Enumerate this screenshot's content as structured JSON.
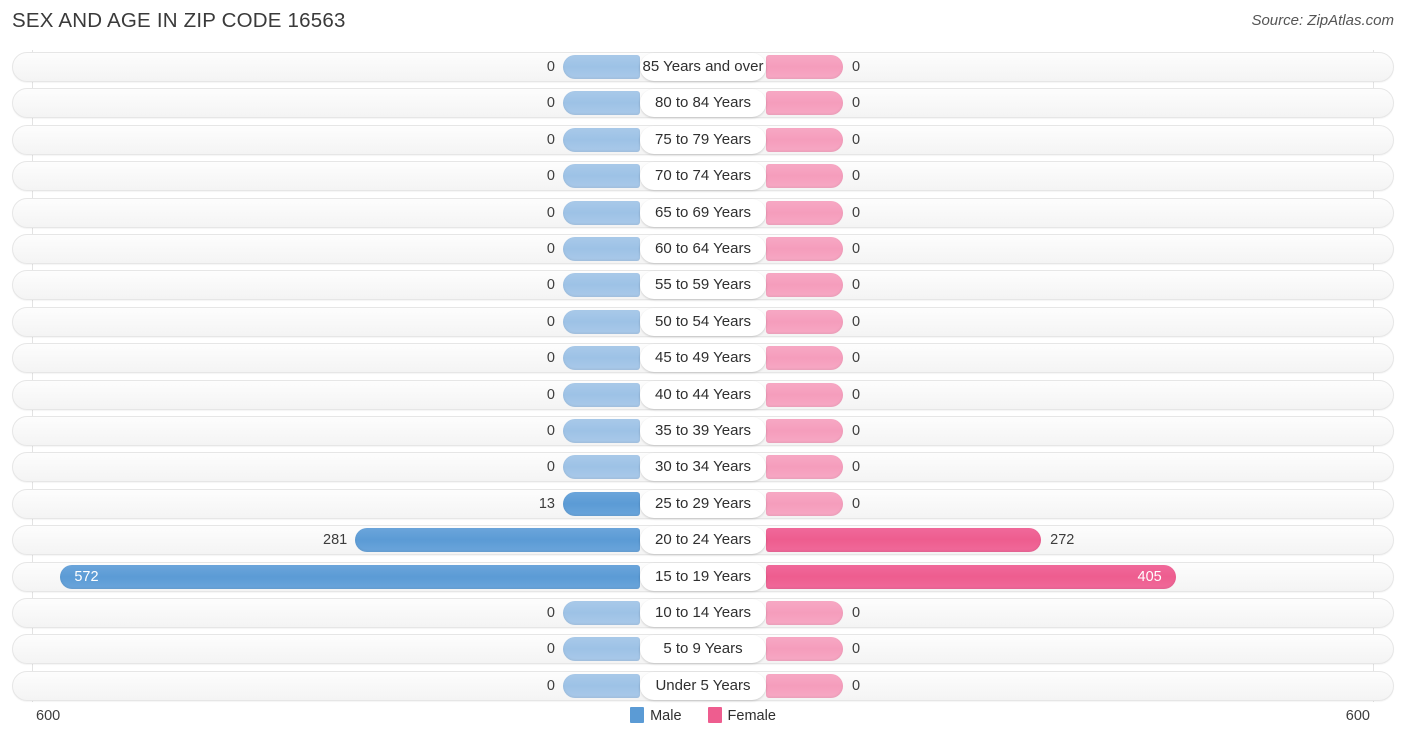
{
  "header": {
    "title": "SEX AND AGE IN ZIP CODE 16563",
    "source": "Source: ZipAtlas.com"
  },
  "axis": {
    "left_max_label": "600",
    "right_max_label": "600"
  },
  "legend": {
    "items": [
      {
        "label": "Male",
        "color": "#5b9bd5",
        "swatch": "male"
      },
      {
        "label": "Female",
        "color": "#ee5d8f",
        "swatch": "female"
      }
    ]
  },
  "colors": {
    "male_solid": "#5b9bd5",
    "female_solid": "#ee5d8f",
    "male_pastel": "#a8c8e8",
    "female_pastel": "#f6a4c0",
    "row_track": "#f4f4f4",
    "gridline": "#e3e3e3"
  },
  "chart_data": {
    "type": "bar",
    "subtype": "population-pyramid",
    "title": "SEX AND AGE IN ZIP CODE 16563",
    "xlabel": "",
    "ylabel": "",
    "xlim": [
      0,
      600
    ],
    "grid": true,
    "legend_position": "bottom-center",
    "categories": [
      "85 Years and over",
      "80 to 84 Years",
      "75 to 79 Years",
      "70 to 74 Years",
      "65 to 69 Years",
      "60 to 64 Years",
      "55 to 59 Years",
      "50 to 54 Years",
      "45 to 49 Years",
      "40 to 44 Years",
      "35 to 39 Years",
      "30 to 34 Years",
      "25 to 29 Years",
      "20 to 24 Years",
      "15 to 19 Years",
      "10 to 14 Years",
      "5 to 9 Years",
      "Under 5 Years"
    ],
    "series": [
      {
        "name": "Male",
        "color": "#5b9bd5",
        "values": [
          0,
          0,
          0,
          0,
          0,
          0,
          0,
          0,
          0,
          0,
          0,
          0,
          13,
          281,
          572,
          0,
          0,
          0
        ]
      },
      {
        "name": "Female",
        "color": "#ee5d8f",
        "values": [
          0,
          0,
          0,
          0,
          0,
          0,
          0,
          0,
          0,
          0,
          0,
          0,
          0,
          272,
          405,
          0,
          0,
          0
        ]
      }
    ]
  },
  "rows": [
    {
      "label": "85 Years and over",
      "male": "0",
      "female": "0"
    },
    {
      "label": "80 to 84 Years",
      "male": "0",
      "female": "0"
    },
    {
      "label": "75 to 79 Years",
      "male": "0",
      "female": "0"
    },
    {
      "label": "70 to 74 Years",
      "male": "0",
      "female": "0"
    },
    {
      "label": "65 to 69 Years",
      "male": "0",
      "female": "0"
    },
    {
      "label": "60 to 64 Years",
      "male": "0",
      "female": "0"
    },
    {
      "label": "55 to 59 Years",
      "male": "0",
      "female": "0"
    },
    {
      "label": "50 to 54 Years",
      "male": "0",
      "female": "0"
    },
    {
      "label": "45 to 49 Years",
      "male": "0",
      "female": "0"
    },
    {
      "label": "40 to 44 Years",
      "male": "0",
      "female": "0"
    },
    {
      "label": "35 to 39 Years",
      "male": "0",
      "female": "0"
    },
    {
      "label": "30 to 34 Years",
      "male": "0",
      "female": "0"
    },
    {
      "label": "25 to 29 Years",
      "male": "13",
      "female": "0"
    },
    {
      "label": "20 to 24 Years",
      "male": "281",
      "female": "272"
    },
    {
      "label": "15 to 19 Years",
      "male": "572",
      "female": "405"
    },
    {
      "label": "10 to 14 Years",
      "male": "0",
      "female": "0"
    },
    {
      "label": "5 to 9 Years",
      "male": "0",
      "female": "0"
    },
    {
      "label": "Under 5 Years",
      "male": "0",
      "female": "0"
    }
  ]
}
